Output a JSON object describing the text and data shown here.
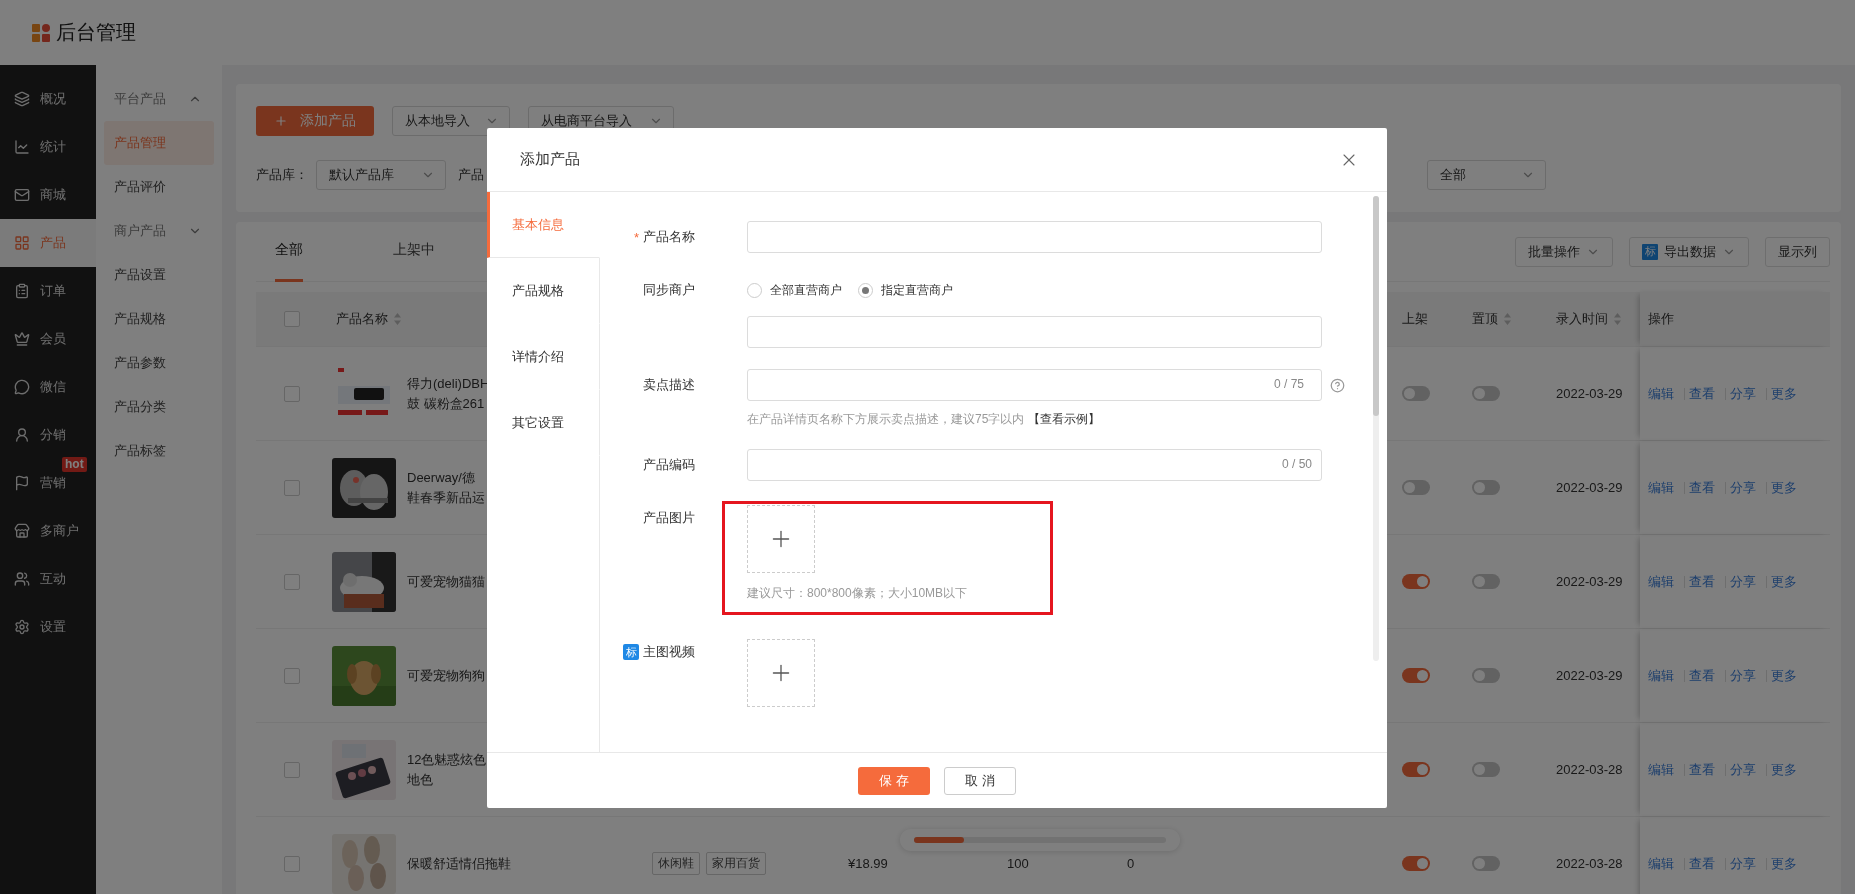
{
  "header": {
    "title": "后台管理"
  },
  "nav": [
    {
      "label": "概况",
      "selected": false
    },
    {
      "label": "统计",
      "selected": false
    },
    {
      "label": "商城",
      "selected": false
    },
    {
      "label": "产品",
      "selected": true
    },
    {
      "label": "订单",
      "selected": false
    },
    {
      "label": "会员",
      "selected": false
    },
    {
      "label": "微信",
      "selected": false
    },
    {
      "label": "分销",
      "selected": false
    },
    {
      "label": "营销",
      "selected": false,
      "badge": "hot"
    },
    {
      "label": "多商户",
      "selected": false
    },
    {
      "label": "互动",
      "selected": false
    },
    {
      "label": "设置",
      "selected": false
    }
  ],
  "subnav": [
    {
      "kind": "group",
      "label": "平台产品",
      "expanded": true
    },
    {
      "kind": "item",
      "label": "产品管理",
      "selected": true
    },
    {
      "kind": "item",
      "label": "产品评价",
      "selected": false
    },
    {
      "kind": "group",
      "label": "商户产品",
      "expanded": false
    },
    {
      "kind": "item",
      "label": "产品设置",
      "selected": false
    },
    {
      "kind": "item",
      "label": "产品规格",
      "selected": false
    },
    {
      "kind": "item",
      "label": "产品参数",
      "selected": false
    },
    {
      "kind": "item",
      "label": "产品分类",
      "selected": false
    },
    {
      "kind": "item",
      "label": "产品标签",
      "selected": false
    }
  ],
  "toolbar": {
    "add_button": "添加产品",
    "import_local": "从本地导入",
    "import_platform": "从电商平台导入"
  },
  "filters": {
    "library_label": "产品库：",
    "library_value": "默认产品库",
    "second_label": "产品",
    "status_value": "全部"
  },
  "table": {
    "tabs": [
      {
        "label": "全部",
        "selected": true
      },
      {
        "label": "上架中",
        "selected": false
      }
    ],
    "all_checked": false,
    "batch": "批量操作",
    "export": "导出数据",
    "export_icon": "标",
    "show_columns": "显示列",
    "columns": [
      {
        "label": "产品名称",
        "sortable": true
      },
      {
        "label": "上架",
        "sortable": false
      },
      {
        "label": "置顶",
        "sortable": true
      },
      {
        "label": "录入时间",
        "sortable": true
      },
      {
        "label": "操作",
        "sortable": false
      }
    ],
    "rows": [
      {
        "name_lines": [
          "得力(deli)DBH",
          "鼓 碳粉盒261"
        ],
        "checked": false,
        "listed": false,
        "pinned": false,
        "date": "2022-03-29",
        "actions": [
          "编辑",
          "查看",
          "分享",
          "更多"
        ]
      },
      {
        "name_lines": [
          "Deerway/德",
          "鞋春季新品运"
        ],
        "checked": false,
        "listed": false,
        "pinned": false,
        "date": "2022-03-29",
        "actions": [
          "编辑",
          "查看",
          "分享",
          "更多"
        ]
      },
      {
        "name_lines": [
          "可爱宠物猫猫"
        ],
        "checked": false,
        "listed": true,
        "pinned": false,
        "date": "2022-03-29",
        "actions": [
          "编辑",
          "查看",
          "分享",
          "更多"
        ]
      },
      {
        "name_lines": [
          "可爱宠物狗狗"
        ],
        "checked": false,
        "listed": true,
        "pinned": false,
        "date": "2022-03-29",
        "actions": [
          "编辑",
          "查看",
          "分享",
          "更多"
        ]
      },
      {
        "name_lines": [
          "12色魅惑炫色",
          "地色"
        ],
        "checked": false,
        "listed": true,
        "pinned": false,
        "date": "2022-03-28",
        "actions": [
          "编辑",
          "查看",
          "分享",
          "更多"
        ]
      },
      {
        "name_lines": [
          "保暖舒适情侣拖鞋"
        ],
        "checked": false,
        "tags": [
          "休闲鞋",
          "家用百货"
        ],
        "price": "¥18.99",
        "sales": "100",
        "stock": "0",
        "listed": true,
        "pinned": false,
        "date": "2022-03-28",
        "actions": [
          "编辑",
          "查看",
          "分享",
          "更多"
        ]
      }
    ]
  },
  "modal": {
    "title": "添加产品",
    "tabs": [
      {
        "label": "基本信息",
        "selected": true
      },
      {
        "label": "产品规格",
        "selected": false
      },
      {
        "label": "详情介绍",
        "selected": false
      },
      {
        "label": "其它设置",
        "selected": false
      }
    ],
    "fields": [
      {
        "kind": "text",
        "label": "产品名称",
        "required_mark": "*"
      },
      {
        "kind": "radio",
        "label": "同步商户",
        "options": [
          {
            "label": "全部直营商户",
            "selected": false
          },
          {
            "label": "指定直营商户",
            "selected": true
          }
        ]
      },
      {
        "kind": "text",
        "label": "卖点描述",
        "counter": "0 / 75",
        "help": true,
        "hint": "在产品详情页名称下方展示卖点描述，建议75字以内",
        "hint_link": "【查看示例】"
      },
      {
        "kind": "text",
        "label": "产品编码",
        "counter": "0 / 50",
        "help": false
      },
      {
        "kind": "upload",
        "label": "产品图片",
        "hint": "建议尺寸：800*800像素；大小10MB以下",
        "highlighted": true
      },
      {
        "kind": "upload",
        "label": "主图视频",
        "tag": "标",
        "highlighted": false
      }
    ],
    "save": "保 存",
    "cancel": "取 消"
  }
}
